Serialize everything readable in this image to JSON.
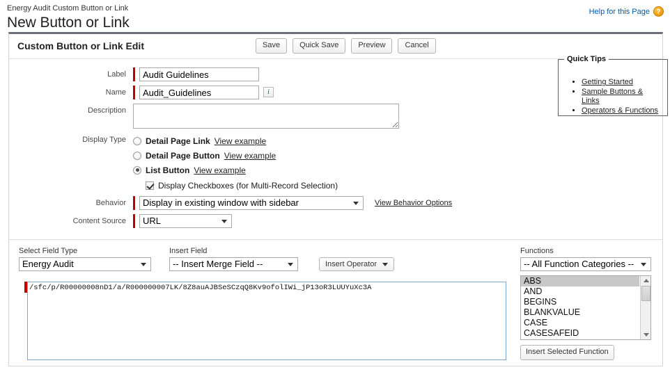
{
  "header": {
    "breadcrumb": "Energy Audit Custom Button or Link",
    "title": "New Button or Link",
    "help_link": "Help for this Page",
    "help_icon": "question-mark-icon",
    "help_icon_glyph": "?",
    "help_link_color": "#015ba7"
  },
  "panel": {
    "title": "Custom Button or Link Edit",
    "buttons": [
      {
        "label": "Save"
      },
      {
        "label": "Quick Save"
      },
      {
        "label": "Preview"
      },
      {
        "label": "Cancel"
      }
    ]
  },
  "form": {
    "label_field": {
      "label": "Label",
      "value": "Audit Guidelines",
      "required": true
    },
    "name_field": {
      "label": "Name",
      "value": "Audit_Guidelines",
      "required": true,
      "info_icon": "info-icon",
      "info_glyph": "i"
    },
    "description_field": {
      "label": "Description",
      "value": "",
      "placeholder": ""
    },
    "display_type": {
      "label": "Display Type",
      "options": [
        {
          "label": "Detail Page Link",
          "example": "View example",
          "selected": false
        },
        {
          "label": "Detail Page Button",
          "example": "View example",
          "selected": false
        },
        {
          "label": "List Button",
          "example": "View example",
          "selected": true
        }
      ],
      "checkbox": {
        "label": "Display Checkboxes (for Multi-Record Selection)",
        "checked": true
      }
    },
    "behavior": {
      "label": "Behavior",
      "value": "Display in existing window with sidebar",
      "link": "View Behavior Options",
      "required": true
    },
    "content_source": {
      "label": "Content Source",
      "value": "URL",
      "required": true
    }
  },
  "quick_tips": {
    "legend": "Quick Tips",
    "links": [
      "Getting Started",
      "Sample Buttons & Links",
      "Operators & Functions"
    ]
  },
  "editor": {
    "field_type": {
      "label": "Select Field Type",
      "value": "Energy Audit"
    },
    "insert_field": {
      "label": "Insert Field",
      "value": "-- Insert Merge Field --"
    },
    "insert_operator": {
      "label": "Insert Operator"
    },
    "formula": {
      "value": "/sfc/p/R00000008nD1/a/R000000007LK/8Z8auAJBSeSCzqQ8Kv9ofolIWi_jP13oR3LUUYuXc3A",
      "required": true,
      "border_color": "#7aa7d4"
    }
  },
  "functions": {
    "label": "Functions",
    "category": "-- All Function Categories --",
    "items": [
      {
        "name": "ABS",
        "selected": true
      },
      {
        "name": "AND",
        "selected": false
      },
      {
        "name": "BEGINS",
        "selected": false
      },
      {
        "name": "BLANKVALUE",
        "selected": false
      },
      {
        "name": "CASE",
        "selected": false
      },
      {
        "name": "CASESAFEID",
        "selected": false
      }
    ],
    "insert_button": "Insert Selected Function"
  }
}
